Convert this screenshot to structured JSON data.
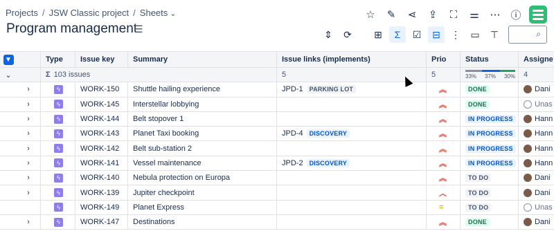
{
  "breadcrumb": {
    "items": [
      "Projects",
      "JSW Classic project",
      "Sheets"
    ]
  },
  "page": {
    "title": "Program management"
  },
  "header": {
    "icons": [
      "star-icon",
      "pencil-icon",
      "share-icon",
      "export-icon",
      "fullscreen-icon",
      "settings-sliders-icon",
      "more-icon",
      "help-icon",
      "app-logo"
    ]
  },
  "toolbar": {
    "icons": [
      "row-height-icon",
      "refresh-icon",
      "add-view-icon",
      "sum-icon",
      "checklist-icon",
      "hierarchy-icon",
      "subtasks-icon",
      "group-icon",
      "format-paint-icon"
    ],
    "active": [
      "sum-icon",
      "hierarchy-icon"
    ]
  },
  "search": {
    "placeholder": ""
  },
  "table": {
    "columns": [
      "Type",
      "Issue key",
      "Summary",
      "Issue links (implements)",
      "Prio",
      "Status",
      "Assigne"
    ],
    "summary": {
      "sigma": "Σ",
      "count": "103 issues",
      "links_count": "5",
      "prio_count": "5",
      "status_pct": [
        "33%",
        "37%",
        "30%"
      ],
      "status_fractions": [
        0.33,
        0.37,
        0.3
      ],
      "assignee_count": "4"
    },
    "rows": [
      {
        "key": "WORK-150",
        "summary": "Shuttle hailing experience",
        "link_key": "JPD-1",
        "link_label": "PARKING LOT",
        "prio": "highest",
        "status": "DONE",
        "assignee": "Dani",
        "unassigned": false,
        "expand": true
      },
      {
        "key": "WORK-145",
        "summary": "Interstellar lobbying",
        "link_key": "",
        "link_label": "",
        "prio": "highest",
        "status": "DONE",
        "assignee": "Unas",
        "unassigned": true,
        "expand": true
      },
      {
        "key": "WORK-144",
        "summary": "Belt stopover 1",
        "link_key": "",
        "link_label": "",
        "prio": "highest",
        "status": "IN PROGRESS",
        "assignee": "Hann",
        "unassigned": false,
        "expand": true
      },
      {
        "key": "WORK-143",
        "summary": "Planet Taxi booking",
        "link_key": "JPD-4",
        "link_label": "DISCOVERY",
        "prio": "highest",
        "status": "IN PROGRESS",
        "assignee": "Hann",
        "unassigned": false,
        "expand": true
      },
      {
        "key": "WORK-142",
        "summary": "Belt sub-station 2",
        "link_key": "",
        "link_label": "",
        "prio": "highest",
        "status": "IN PROGRESS",
        "assignee": "Hann",
        "unassigned": false,
        "expand": true
      },
      {
        "key": "WORK-141",
        "summary": "Vessel maintenance",
        "link_key": "JPD-2",
        "link_label": "DISCOVERY",
        "prio": "highest",
        "status": "IN PROGRESS",
        "assignee": "Hann",
        "unassigned": false,
        "expand": true
      },
      {
        "key": "WORK-140",
        "summary": "Nebula protection on Europa",
        "link_key": "",
        "link_label": "",
        "prio": "highest",
        "status": "TO DO",
        "assignee": "Dani",
        "unassigned": false,
        "expand": true
      },
      {
        "key": "WORK-139",
        "summary": "Jupiter checkpoint",
        "link_key": "",
        "link_label": "",
        "prio": "high",
        "status": "TO DO",
        "assignee": "Dani",
        "unassigned": false,
        "expand": true
      },
      {
        "key": "WORK-149",
        "summary": "Planet Express",
        "link_key": "",
        "link_label": "",
        "prio": "medium",
        "status": "TO DO",
        "assignee": "Unas",
        "unassigned": true,
        "expand": false
      },
      {
        "key": "WORK-147",
        "summary": "Destinations",
        "link_key": "",
        "link_label": "",
        "prio": "highest",
        "status": "DONE",
        "assignee": "Dani",
        "unassigned": false,
        "expand": true
      }
    ]
  },
  "colors": {
    "accent": "#0c66e4",
    "done": "#216e4e",
    "in_progress": "#0055cc",
    "priority_high": "#e2483d",
    "priority_medium": "#e2b203",
    "logo": "#2dbf73"
  }
}
